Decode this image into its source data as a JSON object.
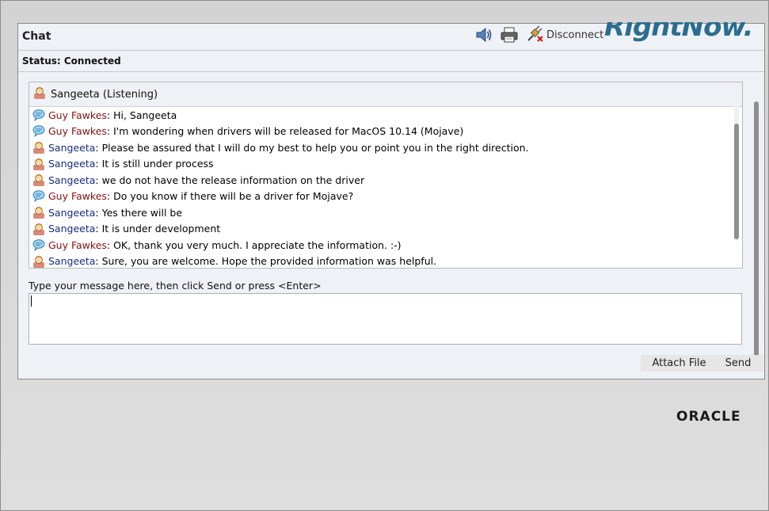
{
  "brand": {
    "text": "RightNow."
  },
  "header": {
    "title": "Chat",
    "disconnect_label": "Disconnect"
  },
  "toolbar_icons": [
    "speaker-icon",
    "printer-icon",
    "disconnect-plug-icon"
  ],
  "status": {
    "text": "Status: Connected"
  },
  "participant": {
    "label": "Sangeeta (Listening)"
  },
  "messages": [
    {
      "sender": "Guy Fawkes",
      "role": "visitor",
      "text": ": Hi, Sangeeta"
    },
    {
      "sender": "Guy Fawkes",
      "role": "visitor",
      "text": ": I'm wondering when drivers will be released for MacOS 10.14 (Mojave)"
    },
    {
      "sender": "Sangeeta",
      "role": "agent",
      "text": ": Please be assured that I will do my best to help you or point you in the right direction."
    },
    {
      "sender": "Sangeeta",
      "role": "agent",
      "text": ": It is still under process"
    },
    {
      "sender": "Sangeeta",
      "role": "agent",
      "text": ": we do not have the release information on the driver"
    },
    {
      "sender": "Guy Fawkes",
      "role": "visitor",
      "text": ": Do you know if there will be a driver for Mojave?"
    },
    {
      "sender": "Sangeeta",
      "role": "agent",
      "text": ": Yes there will be"
    },
    {
      "sender": "Sangeeta",
      "role": "agent",
      "text": ": It is under development"
    },
    {
      "sender": "Guy Fawkes",
      "role": "visitor",
      "text": ": OK, thank you very much. I appreciate the information. :-)"
    },
    {
      "sender": "Sangeeta",
      "role": "agent",
      "text": ": Sure, you are welcome. Hope the provided information was helpful."
    }
  ],
  "compose": {
    "prompt": "Type your message here, then click Send or press <Enter>",
    "value": ""
  },
  "buttons": {
    "attach_label": "Attach File",
    "send_label": "Send"
  },
  "footer": {
    "logo_text": "ORACLE"
  },
  "colors": {
    "visitor_name": "#8b1010",
    "agent_name": "#1a2a86",
    "panel_bg": "#eef1f6",
    "brand_logo": "#2c6d8f"
  }
}
